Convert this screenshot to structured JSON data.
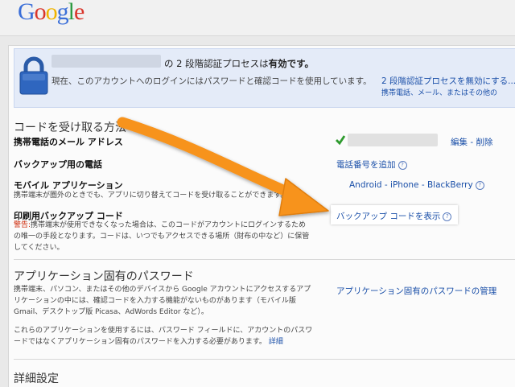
{
  "header": {
    "logo_letters": [
      {
        "ch": "G",
        "color": "#3b6fd8"
      },
      {
        "ch": "o",
        "color": "#d9352a"
      },
      {
        "ch": "o",
        "color": "#f0b400"
      },
      {
        "ch": "g",
        "color": "#3b6fd8"
      },
      {
        "ch": "l",
        "color": "#2d9a42"
      },
      {
        "ch": "e",
        "color": "#d9352a"
      }
    ]
  },
  "banner": {
    "status_prefix": "の 2 段階認証プロセスは",
    "status_value": "有効です。",
    "description": "現在、このアカウントへのログインにはパスワードと確認コードを使用しています。",
    "disable_link": "2 段階認証プロセスを無効にする...",
    "disable_sub": "携帯電話、メール、またはその他の"
  },
  "code_section": {
    "title": "コードを受け取る方法",
    "items": [
      {
        "label": "携帯電話のメール アドレス",
        "action": "編集 - 削除"
      },
      {
        "label": "バックアップ用の電話",
        "action": "電話番号を追加"
      },
      {
        "label": "モバイル アプリケーション",
        "desc": "携帯端末が圏外のときでも、アプリに切り替えてコードを受け取ることができます。",
        "action": "Android - iPhone - BlackBerry"
      },
      {
        "label": "印刷用バックアップ コード",
        "warn_prefix": "警告:",
        "desc": "携帯端末が使用できなくなった場合は、このコードがアカウントにログインするための唯一の手段となります。コードは、いつでもアクセスできる場所（財布の中など）に保管してください。",
        "action": "バックアップ コードを表示"
      }
    ]
  },
  "app_section": {
    "title": "アプリケーション固有のパスワード",
    "desc1": "携帯端末、パソコン、またはその他のデバイスから Google アカウントにアクセスするアプリケーションの中には、確認コードを入力する機能がないものがあります（モバイル版 Gmail、デスクトップ版 Picasa、AdWords Editor など）。",
    "desc2": "これらのアプリケーションを使用するには、パスワード フィールドに、アカウントのパスワードではなくアプリケーション固有のパスワードを入力する必要があります。",
    "details_link": "詳細",
    "manage_link": "アプリケーション固有のパスワードの管理"
  },
  "details_section": {
    "title": "詳細設定"
  },
  "colors": {
    "link": "#1a4fa8",
    "arrow": "#f7931e",
    "check": "#2e9a2e"
  }
}
